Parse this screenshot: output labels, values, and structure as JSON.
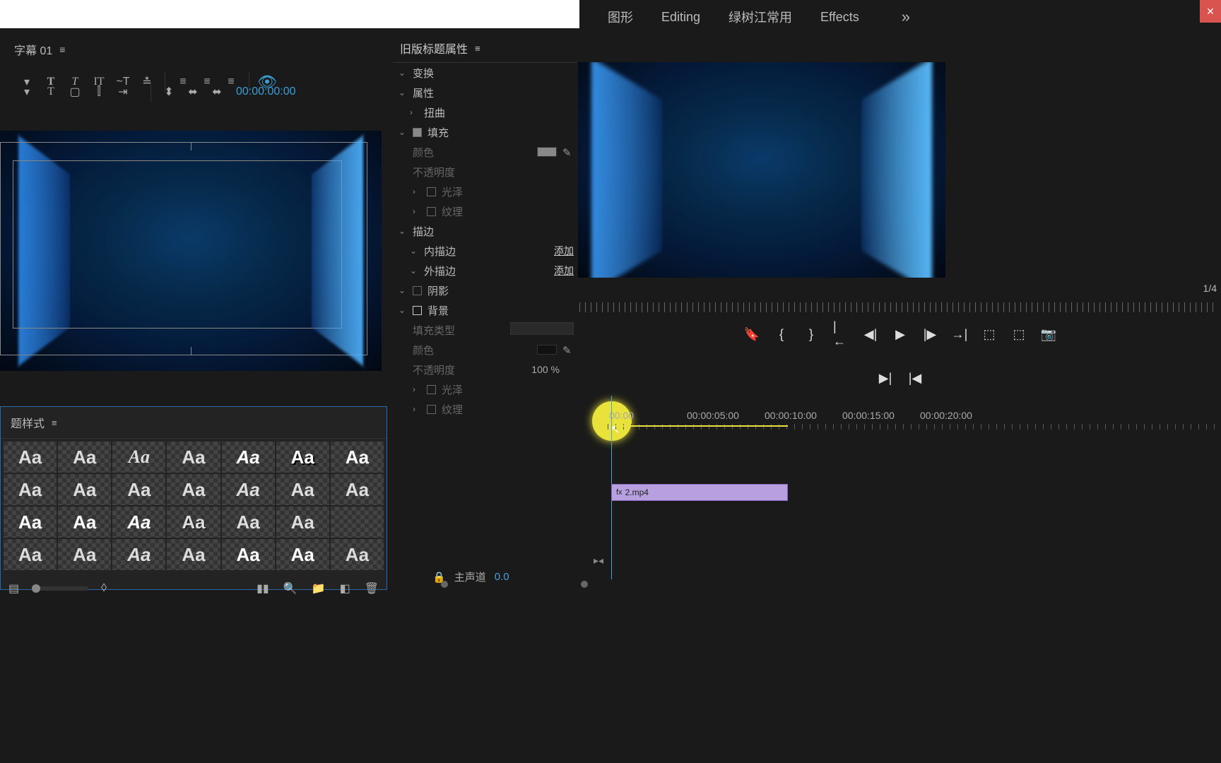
{
  "top_menu": {
    "graphics": "图形",
    "editing": "Editing",
    "custom": "绿树江常用",
    "effects": "Effects"
  },
  "title_panel": {
    "label": "字幕 01",
    "timecode": "00:00:00:00"
  },
  "styles_panel": {
    "title": "题样式"
  },
  "props": {
    "title": "旧版标题属性",
    "transform": "变换",
    "attributes": "属性",
    "distort": "扭曲",
    "fill": "填充",
    "color": "颜色",
    "opacity": "不透明度",
    "sheen": "光泽",
    "texture": "纹理",
    "stroke": "描边",
    "inner_stroke": "内描边",
    "outer_stroke": "外描边",
    "add": "添加",
    "shadow": "阴影",
    "background": "背景",
    "fill_type": "填充类型",
    "opacity_val": "100 %"
  },
  "monitor": {
    "zoom": "1/4"
  },
  "timeline": {
    "marks": [
      "00:00",
      "00:00:05:00",
      "00:00:10:00",
      "00:00:15:00",
      "00:00:20:00"
    ],
    "clip_name": "2.mp4"
  },
  "audio": {
    "label": "主声道",
    "value": "0.0"
  }
}
